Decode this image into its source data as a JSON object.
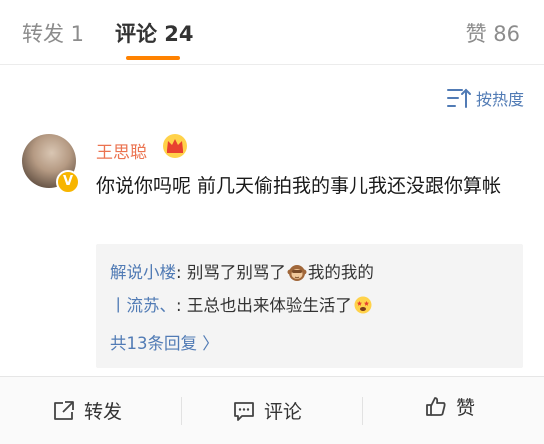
{
  "tabs": {
    "repost": "转发 1",
    "comments": "评论 24",
    "likes": "赞 86",
    "active_color": "#ff8200"
  },
  "sort": {
    "label": "按热度",
    "icon": "sort-lines-icon"
  },
  "comment": {
    "username": "王思聪",
    "badge_icon": "crown-icon",
    "verified_icon": "verified-v-icon",
    "text": "你说你吗呢 前几天偷拍我的事儿我还没跟你算帐",
    "username_color": "#eb7350"
  },
  "replies": [
    {
      "user": "解说小楼",
      "separator": ": ",
      "text_before": "别骂了别骂了",
      "emoji": "monkey-emoji-icon",
      "text_after": "我的我的"
    },
    {
      "user": "丨流苏、",
      "separator": ": ",
      "text_before": "王总也出来体验生活了",
      "emoji": "star-struck-emoji-icon",
      "text_after": ""
    }
  ],
  "more_replies": "共13条回复 〉",
  "actions": {
    "repost": "转发",
    "comment": "评论",
    "like": "赞"
  },
  "link_color": "#517bb5"
}
